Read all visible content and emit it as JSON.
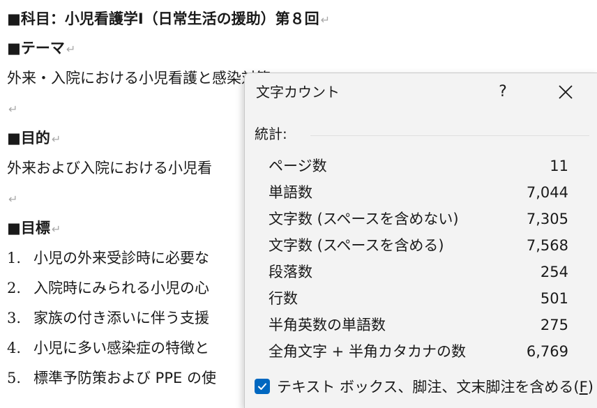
{
  "document": {
    "title": "■科目：小児看護学Ⅰ（日常生活の援助）第８回",
    "theme_heading": "■テーマ",
    "theme_text": "外来・入院における小児看護と感染対策",
    "purpose_heading": "■目的",
    "purpose_text": "外来および入院における小児看",
    "goals_heading": "■目標",
    "goals": [
      {
        "num": "1.",
        "text": "小児の外来受診時に必要な"
      },
      {
        "num": "2.",
        "text": "入院時にみられる小児の心"
      },
      {
        "num": "3.",
        "text": "家族の付き添いに伴う支援"
      },
      {
        "num": "4.",
        "text": "小児に多い感染症の特徴と"
      },
      {
        "num": "5.",
        "text": "標準予防策および PPE の使"
      }
    ],
    "paragraph_mark": "↵"
  },
  "dialog": {
    "title": "文字カウント",
    "help_label": "?",
    "section_label": "統計:",
    "stats": [
      {
        "label": "ページ数",
        "value": "11"
      },
      {
        "label": "単語数",
        "value": "7,044"
      },
      {
        "label": "文字数 (スペースを含めない)",
        "value": "7,305"
      },
      {
        "label": "文字数 (スペースを含める)",
        "value": "7,568"
      },
      {
        "label": "段落数",
        "value": "254"
      },
      {
        "label": "行数",
        "value": "501"
      },
      {
        "label": "半角英数の単語数",
        "value": "275"
      },
      {
        "label": "全角文字 + 半角カタカナの数",
        "value": "6,769"
      }
    ],
    "checkbox_label": "テキスト ボックス、脚注、文末脚注を含める(",
    "checkbox_accesskey": "F",
    "checkbox_label_end": ")",
    "checkbox_checked": true
  },
  "colors": {
    "accent": "#0067c0",
    "dialog_bg": "#f3f3f3"
  }
}
